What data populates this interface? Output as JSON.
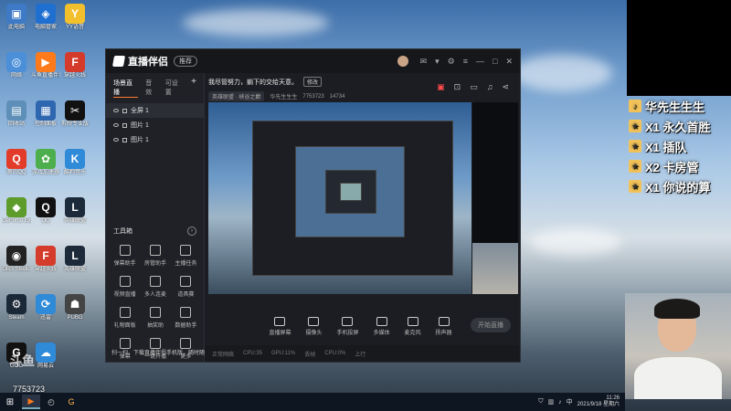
{
  "desktop": {
    "icons": [
      {
        "label": "此电脑",
        "color": "#3e7ac6",
        "glyph": "▣"
      },
      {
        "label": "电脑管家",
        "color": "#1f6fd1",
        "glyph": "◈"
      },
      {
        "label": "YY语音",
        "color": "#f2c02c",
        "glyph": "Y"
      },
      {
        "label": "网络",
        "color": "#4a8fd8",
        "glyph": "◎"
      },
      {
        "label": "斗鱼直播伴侣",
        "color": "#ff7a1a",
        "glyph": "▶"
      },
      {
        "label": "穿越火线",
        "color": "#d43b2a",
        "glyph": "F"
      },
      {
        "label": "回收站",
        "color": "#5d8fb8",
        "glyph": "▤"
      },
      {
        "label": "控制面板",
        "color": "#2e67b0",
        "glyph": "▦"
      },
      {
        "label": "剪映专业版",
        "color": "#111111",
        "glyph": "✂"
      },
      {
        "label": "腾讯QQ",
        "color": "#e23b2a",
        "glyph": "Q"
      },
      {
        "label": "游戏加速器",
        "color": "#4cae4c",
        "glyph": "✿"
      },
      {
        "label": "酷狗音乐",
        "color": "#2f8ad8",
        "glyph": "K"
      },
      {
        "label": "GeForce Experience",
        "color": "#5d9b2a",
        "glyph": "◆"
      },
      {
        "label": "QQ",
        "color": "#111111",
        "glyph": "Q"
      },
      {
        "label": "英雄联盟",
        "color": "#1c2a3a",
        "glyph": "L"
      },
      {
        "label": "OBS Studio",
        "color": "#222222",
        "glyph": "◉"
      },
      {
        "label": "穿越火线",
        "color": "#d43b2a",
        "glyph": "F"
      },
      {
        "label": "英雄联盟",
        "color": "#1c2a3a",
        "glyph": "L"
      },
      {
        "label": "Steam",
        "color": "#1b2838",
        "glyph": "⚙"
      },
      {
        "label": "迅雷",
        "color": "#2f8ad8",
        "glyph": "⟳"
      },
      {
        "label": "PUBG",
        "color": "#444444",
        "glyph": "☗"
      },
      {
        "label": "GOG",
        "color": "#111111",
        "glyph": "G"
      },
      {
        "label": "网易云",
        "color": "#2f8ad8",
        "glyph": "☁"
      }
    ]
  },
  "app": {
    "brand": "直播伴侣",
    "title_pill": "推荐",
    "scene_tabs": [
      "场景直播",
      "音效",
      "可设置"
    ],
    "scenes": [
      "全屏 1",
      "图片 1",
      "图片 1"
    ],
    "tools_title": "工具箱",
    "tools": [
      "弹幕助手",
      "房管助手",
      "主播任务",
      "视频直播",
      "多人连麦",
      "道具赛",
      "礼物面板",
      "抽奖助",
      "数据助手",
      "弹幕",
      "一键开播",
      "更多"
    ],
    "stream_title": "我尽管努力，躺下的交给天意。",
    "edit_label": "修改",
    "category": "英雄联盟 · 峡谷之巅",
    "streamer": "华先生生生",
    "room_id": "7753723",
    "heat": "14734",
    "bottom_tools": [
      "直播屏幕",
      "摄像头",
      "手机投屏",
      "多媒体",
      "麦克风",
      "扬声器"
    ],
    "start_label": "开始直播",
    "status_items": [
      "正常网络",
      "CPU:35",
      "GPU:11%",
      "丢帧",
      "CPU:0%",
      "上行"
    ],
    "notice": "扫一扫，下载直播伴侣手机版，随时随地开播"
  },
  "ranking": [
    {
      "text": "华先生生生",
      "icon": "♪"
    },
    {
      "text": "X1 永久首胜",
      "icon": "★"
    },
    {
      "text": "X1 插队",
      "icon": "★"
    },
    {
      "text": "X2 卡房管",
      "icon": "★"
    },
    {
      "text": "X1 你说的算",
      "icon": "★"
    }
  ],
  "overlay": {
    "watermark": "斗鱼",
    "room_number": "7753723"
  },
  "taskbar": {
    "time": "11:26",
    "date": "2021/9/18 星期六",
    "lang": "中"
  }
}
